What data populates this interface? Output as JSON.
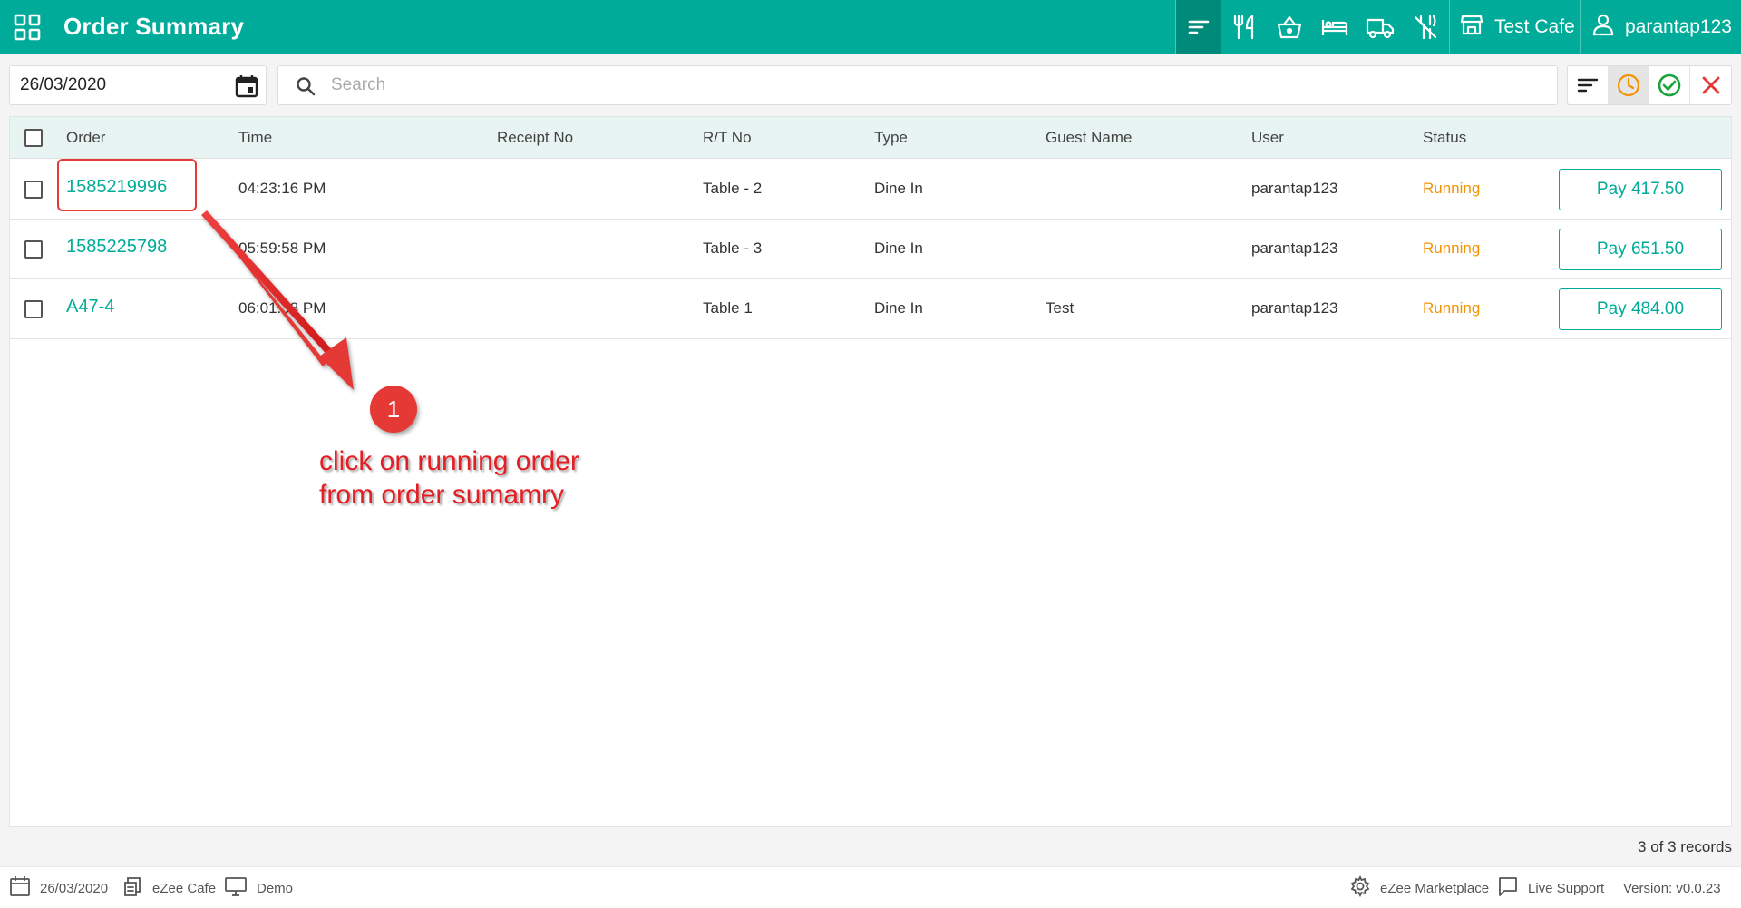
{
  "header": {
    "title": "Order Summary",
    "store_name": "Test Cafe",
    "username": "parantap123",
    "nav_icons": [
      "sort-icon",
      "restaurant-icon",
      "basket-icon",
      "bed-icon",
      "truck-icon",
      "no-dining-icon"
    ],
    "bg_color": "#00AC99"
  },
  "toolbar": {
    "date_value": "26/03/2020",
    "search_placeholder": "Search",
    "filters": [
      "sort-icon",
      "clock-icon",
      "check-circle-icon",
      "close-icon"
    ]
  },
  "table": {
    "columns": [
      "Order",
      "Time",
      "Receipt No",
      "R/T No",
      "Type",
      "Guest Name",
      "User",
      "Status"
    ],
    "rows": [
      {
        "order": "1585219996",
        "time": "04:23:16 PM",
        "receipt": "",
        "rt": "Table - 2",
        "type": "Dine In",
        "guest": "",
        "user": "parantap123",
        "status": "Running",
        "pay": "Pay 417.50"
      },
      {
        "order": "1585225798",
        "time": "05:59:58 PM",
        "receipt": "",
        "rt": "Table - 3",
        "type": "Dine In",
        "guest": "",
        "user": "parantap123",
        "status": "Running",
        "pay": "Pay 651.50"
      },
      {
        "order": "A47-4",
        "time": "06:01:38 PM",
        "receipt": "",
        "rt": "Table 1",
        "type": "Dine In",
        "guest": "Test",
        "user": "parantap123",
        "status": "Running",
        "pay": "Pay 484.00"
      }
    ],
    "records": "3 of 3 records"
  },
  "footer": {
    "date": "26/03/2020",
    "property": "eZee Cafe",
    "terminal": "Demo",
    "marketplace": "eZee Marketplace",
    "support": "Live Support",
    "version": "Version: v0.0.23"
  },
  "annotation": {
    "step": "1",
    "text": "click on running order from order sumamry",
    "color": "#E53935"
  }
}
